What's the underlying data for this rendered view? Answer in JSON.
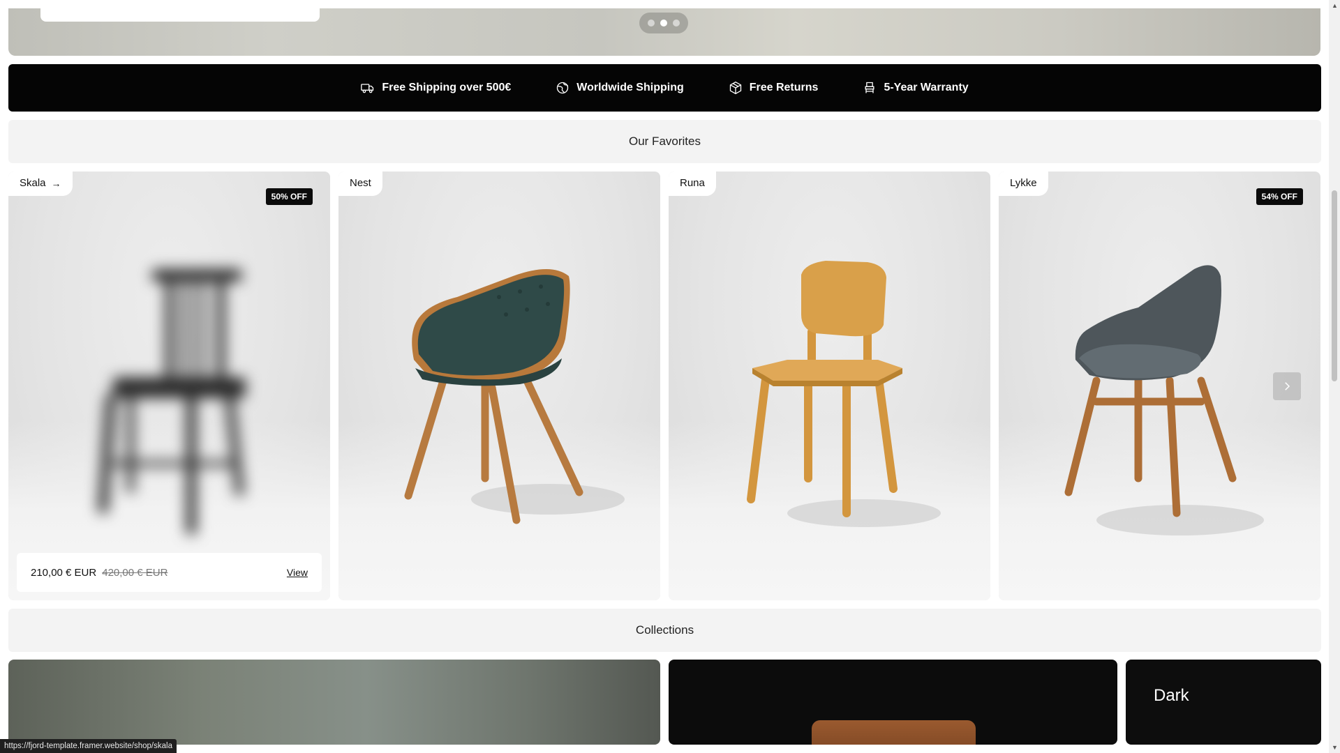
{
  "hero": {
    "slides": 3,
    "active_slide": 2
  },
  "features": [
    {
      "icon": "truck-icon",
      "label": "Free Shipping over 500€"
    },
    {
      "icon": "globe-icon",
      "label": "Worldwide Shipping"
    },
    {
      "icon": "package-icon",
      "label": "Free Returns"
    },
    {
      "icon": "chair-icon",
      "label": "5-Year Warranty"
    }
  ],
  "favorites": {
    "title": "Our Favorites",
    "products": [
      {
        "name": "Skala",
        "badge": "50% OFF",
        "price": "210,00 € EUR",
        "old_price": "420,00 € EUR",
        "view_label": "View",
        "arrow": "→"
      },
      {
        "name": "Nest"
      },
      {
        "name": "Runa"
      },
      {
        "name": "Lykke",
        "badge": "54% OFF"
      }
    ]
  },
  "collections": {
    "title": "Collections",
    "items": [
      {
        "name": ""
      },
      {
        "name": ""
      },
      {
        "name": "Dark"
      }
    ]
  },
  "status_url": "https://fjord-template.framer.website/shop/skala",
  "colors": {
    "bar": "#050505",
    "section_bg": "#f3f3f3",
    "badge_bg": "#0b0b0b"
  }
}
